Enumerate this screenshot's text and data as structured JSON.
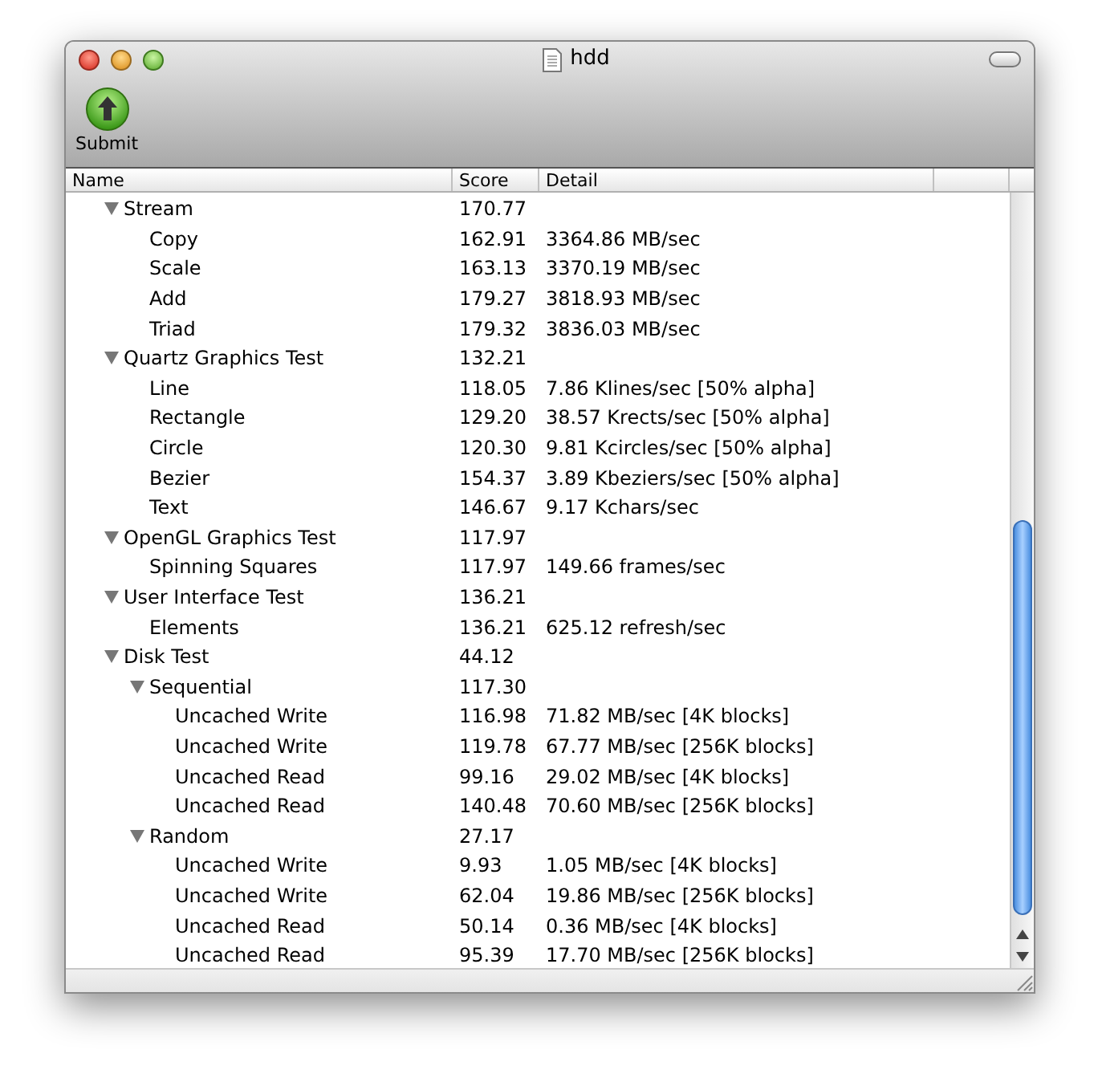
{
  "window": {
    "title": "hdd"
  },
  "toolbar": {
    "items": [
      {
        "label": "Submit"
      }
    ]
  },
  "table": {
    "columns": [
      "Name",
      "Score",
      "Detail"
    ],
    "rows": [
      {
        "name": "Stream",
        "score": "170.77",
        "expanded": true,
        "children": [
          {
            "name": "Copy",
            "score": "162.91",
            "detail": "3364.86 MB/sec"
          },
          {
            "name": "Scale",
            "score": "163.13",
            "detail": "3370.19 MB/sec"
          },
          {
            "name": "Add",
            "score": "179.27",
            "detail": "3818.93 MB/sec"
          },
          {
            "name": "Triad",
            "score": "179.32",
            "detail": "3836.03 MB/sec"
          }
        ]
      },
      {
        "name": "Quartz Graphics Test",
        "score": "132.21",
        "expanded": true,
        "children": [
          {
            "name": "Line",
            "score": "118.05",
            "detail": "7.86 Klines/sec [50% alpha]"
          },
          {
            "name": "Rectangle",
            "score": "129.20",
            "detail": "38.57 Krects/sec [50% alpha]"
          },
          {
            "name": "Circle",
            "score": "120.30",
            "detail": "9.81 Kcircles/sec [50% alpha]"
          },
          {
            "name": "Bezier",
            "score": "154.37",
            "detail": "3.89 Kbeziers/sec [50% alpha]"
          },
          {
            "name": "Text",
            "score": "146.67",
            "detail": "9.17 Kchars/sec"
          }
        ]
      },
      {
        "name": "OpenGL Graphics Test",
        "score": "117.97",
        "expanded": true,
        "children": [
          {
            "name": "Spinning Squares",
            "score": "117.97",
            "detail": "149.66 frames/sec"
          }
        ]
      },
      {
        "name": "User Interface Test",
        "score": "136.21",
        "expanded": true,
        "children": [
          {
            "name": "Elements",
            "score": "136.21",
            "detail": "625.12 refresh/sec"
          }
        ]
      },
      {
        "name": "Disk Test",
        "score": "44.12",
        "expanded": true,
        "children": [
          {
            "name": "Sequential",
            "score": "117.30",
            "expanded": true,
            "children": [
              {
                "name": "Uncached Write",
                "score": "116.98",
                "detail": "71.82 MB/sec [4K blocks]"
              },
              {
                "name": "Uncached Write",
                "score": "119.78",
                "detail": "67.77 MB/sec [256K blocks]"
              },
              {
                "name": "Uncached Read",
                "score": "99.16",
                "detail": "29.02 MB/sec [4K blocks]"
              },
              {
                "name": "Uncached Read",
                "score": "140.48",
                "detail": "70.60 MB/sec [256K blocks]"
              }
            ]
          },
          {
            "name": "Random",
            "score": "27.17",
            "expanded": true,
            "children": [
              {
                "name": "Uncached Write",
                "score": "9.93",
                "detail": "1.05 MB/sec [4K blocks]"
              },
              {
                "name": "Uncached Write",
                "score": "62.04",
                "detail": "19.86 MB/sec [256K blocks]"
              },
              {
                "name": "Uncached Read",
                "score": "50.14",
                "detail": "0.36 MB/sec [4K blocks]"
              },
              {
                "name": "Uncached Read",
                "score": "95.39",
                "detail": "17.70 MB/sec [256K blocks]"
              }
            ]
          }
        ]
      }
    ]
  }
}
